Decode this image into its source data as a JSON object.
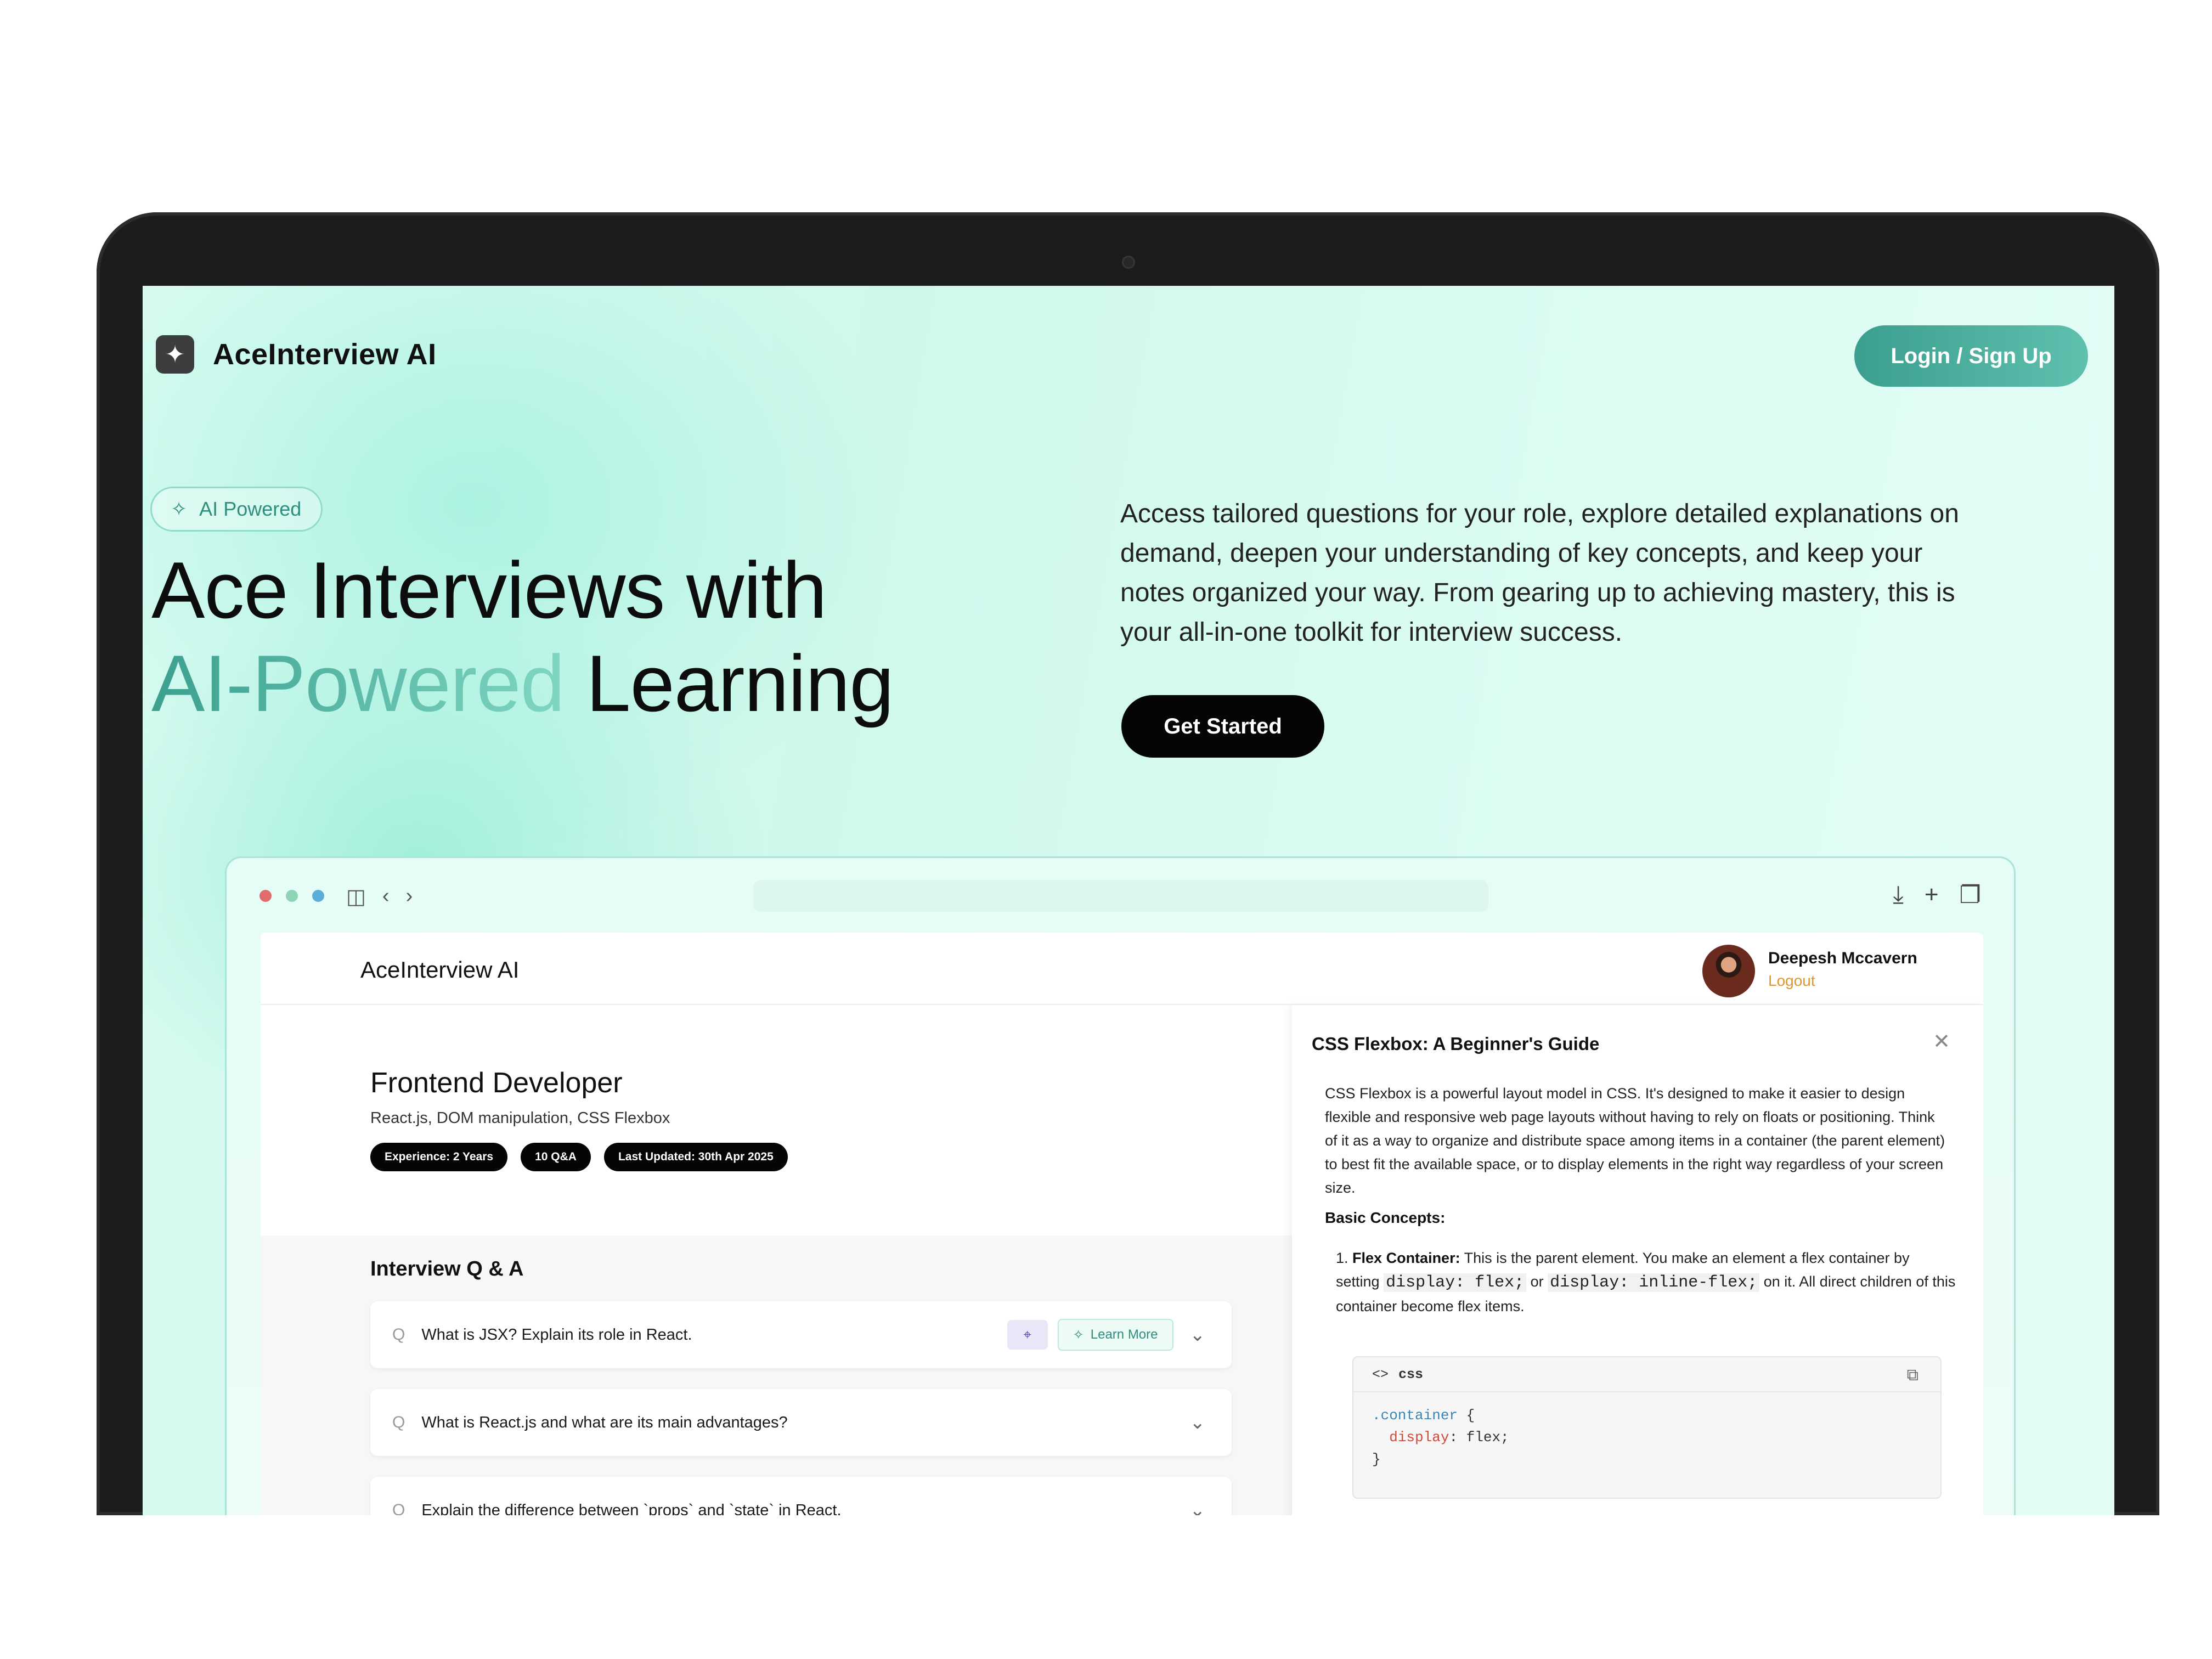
{
  "brand": {
    "name": "AceInterview AI",
    "logo_icon": "sparkles-icon"
  },
  "nav": {
    "login_label": "Login / Sign Up"
  },
  "hero": {
    "badge": "AI Powered",
    "title_line1": "Ace Interviews with",
    "title_accent": "AI-Powered",
    "title_rest": "Learning",
    "description": "Access tailored questions for your role, explore detailed explanations on demand, deepen your understanding of key concepts, and keep your notes organized your way. From gearing up to achieving mastery, this is your all-in-one toolkit for interview success.",
    "cta_label": "Get Started"
  },
  "colors": {
    "accent": "#3c9e8e",
    "accent_light": "#7fd6c3",
    "dot_red": "#e06c6c",
    "dot_green": "#8fd3b6",
    "dot_blue": "#5aaed8",
    "logout": "#e0962a"
  },
  "preview": {
    "app_title": "AceInterview AI",
    "user": {
      "name": "Deepesh Mccavern",
      "logout": "Logout"
    },
    "session": {
      "role": "Frontend Developer",
      "skills": "React.js, DOM manipulation, CSS Flexbox",
      "chips": [
        "Experience: 2 Years",
        "10 Q&A",
        "Last Updated: 30th Apr 2025"
      ]
    },
    "qa": {
      "heading": "Interview Q & A",
      "learn_more": "Learn More",
      "items": [
        {
          "q": "Q",
          "text": "What is JSX? Explain its role in React."
        },
        {
          "q": "Q",
          "text": "What is React.js and what are its main advantages?"
        },
        {
          "q": "Q",
          "text": "Explain the difference between `props` and `state` in React."
        }
      ]
    },
    "guide": {
      "title": "CSS Flexbox: A Beginner's Guide",
      "intro": "CSS Flexbox is a powerful layout model in CSS. It's designed to make it easier to design flexible and responsive web page layouts without having to rely on floats or positioning. Think of it as a way to organize and distribute space among items in a container (the parent element) to best fit the available space, or to display elements in the right way regardless of your screen size.",
      "basic_heading": "Basic Concepts:",
      "item1_num": "1.",
      "item1_label": "Flex Container:",
      "item1_text_a": "This is the parent element. You make an element a flex container by setting",
      "item1_code_a": "display: flex;",
      "item1_or": "or",
      "item1_code_b": "display: inline-flex;",
      "item1_text_b": "on it. All direct children of this container become flex items.",
      "code_lang": "css",
      "code_line1_sel": ".container",
      "code_line1_rest": " {",
      "code_line2_prop": "display",
      "code_line2_rest": ": flex;",
      "code_line3": "}"
    }
  }
}
